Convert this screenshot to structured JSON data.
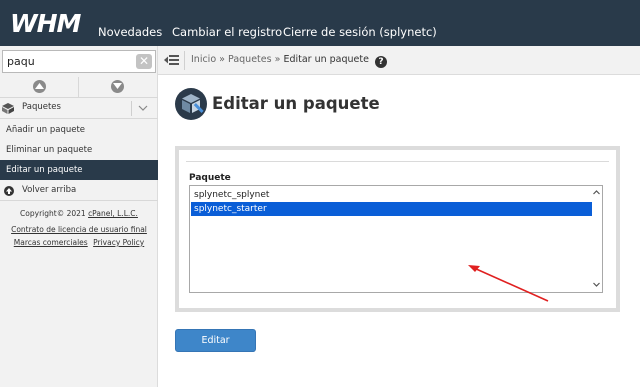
{
  "header": {
    "logo_text": "WHM",
    "nav": [
      "Novedades",
      "Cambiar el registro",
      "Cierre de sesión (splynetc)"
    ]
  },
  "sidebar": {
    "search": {
      "value": "paqu",
      "placeholder": ""
    },
    "category": {
      "label": "Paquetes",
      "icon": "box-icon"
    },
    "items": [
      {
        "label": "Añadir un paquete",
        "active": false
      },
      {
        "label": "Eliminar un paquete",
        "active": false
      },
      {
        "label": "Editar un paquete",
        "active": true
      }
    ],
    "back_to_top": "Volver arriba",
    "footer": {
      "copyright_prefix": "Copyright© 2021 ",
      "copyright_link": "cPanel, L.L.C.",
      "eula": "Contrato de licencia de usuario final",
      "trademarks": "Marcas comerciales",
      "privacy": "Privacy Policy"
    }
  },
  "breadcrumb": {
    "home": "Inicio",
    "section": "Paquetes",
    "current": "Editar un paquete",
    "separator": "»"
  },
  "main": {
    "title": "Editar un paquete",
    "package_label": "Paquete",
    "packages": [
      {
        "name": "splynetc_splynet",
        "selected": false
      },
      {
        "name": "splynetc_starter",
        "selected": true
      }
    ],
    "submit_label": "Editar"
  },
  "colors": {
    "topbar": "#293a4a",
    "active_item": "#293a4a",
    "selected_option": "#0a5ed7",
    "button": "#3e86c9",
    "annotation_arrow": "#e02020"
  }
}
